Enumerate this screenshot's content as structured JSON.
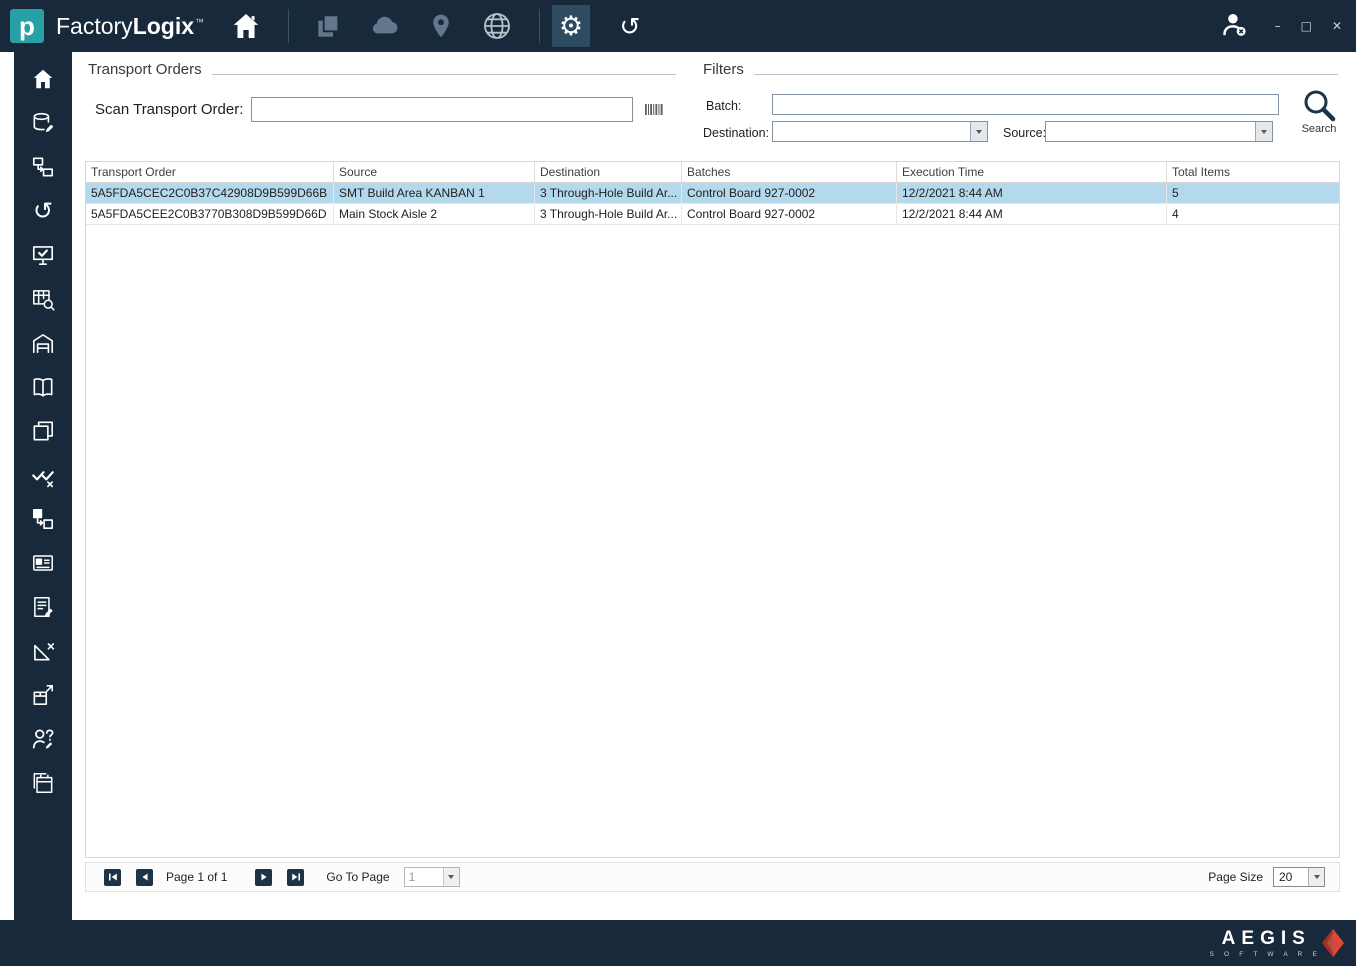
{
  "titlebar": {
    "logo_letter": "p",
    "app_name_light": "Factory",
    "app_name_bold": "Logix",
    "trademark": "™",
    "window_controls": {
      "minimize": "–",
      "maximize": "□",
      "close": "✕"
    }
  },
  "glyphs": {
    "gear": "⚙",
    "history": "↺"
  },
  "toolbar_icons": [
    "layers-copy",
    "cloud",
    "location-pin",
    "globe",
    "gear",
    "history"
  ],
  "sidebar_icons": [
    "home",
    "database-edit",
    "boxes-arrow",
    "history",
    "monitor-check",
    "table-search",
    "warehouse",
    "open-book",
    "copy",
    "double-check",
    "box-transfer",
    "id-card",
    "note-edit",
    "ruler-x",
    "package-arrow",
    "user-question",
    "calendar-copy"
  ],
  "transport_orders": {
    "section_title": "Transport Orders",
    "scan_label": "Scan Transport Order:",
    "scan_value": ""
  },
  "filters": {
    "section_title": "Filters",
    "batch_label": "Batch:",
    "batch_value": "",
    "destination_label": "Destination:",
    "destination_value": "",
    "source_label": "Source:",
    "source_value": "",
    "search_label": "Search"
  },
  "table": {
    "columns": [
      "Transport Order",
      "Source",
      "Destination",
      "Batches",
      "Execution Time",
      "Total Items"
    ],
    "rows": [
      [
        "5A5FDA5CEC2C0B37C42908D9B599D66B",
        "SMT Build Area KANBAN 1",
        "3 Through-Hole Build Ar...",
        "Control Board 927-0002",
        "12/2/2021 8:44 AM",
        "5"
      ],
      [
        "5A5FDA5CEE2C0B3770B308D9B599D66D",
        "Main Stock Aisle 2",
        "3 Through-Hole Build Ar...",
        "Control Board 927-0002",
        "12/2/2021 8:44 AM",
        "4"
      ]
    ],
    "selected_row_index": 0
  },
  "pagination": {
    "page_text": "Page 1 of 1",
    "goto_label": "Go To Page",
    "goto_value": "1",
    "page_size_label": "Page Size",
    "page_size_value": "20"
  },
  "footer": {
    "brand": "AEGIS",
    "brand_sub": "S O F T W A R E"
  },
  "colors": {
    "navy": "#17293a",
    "teal": "#27a1a6",
    "selected_row": "#b4d8ec"
  }
}
